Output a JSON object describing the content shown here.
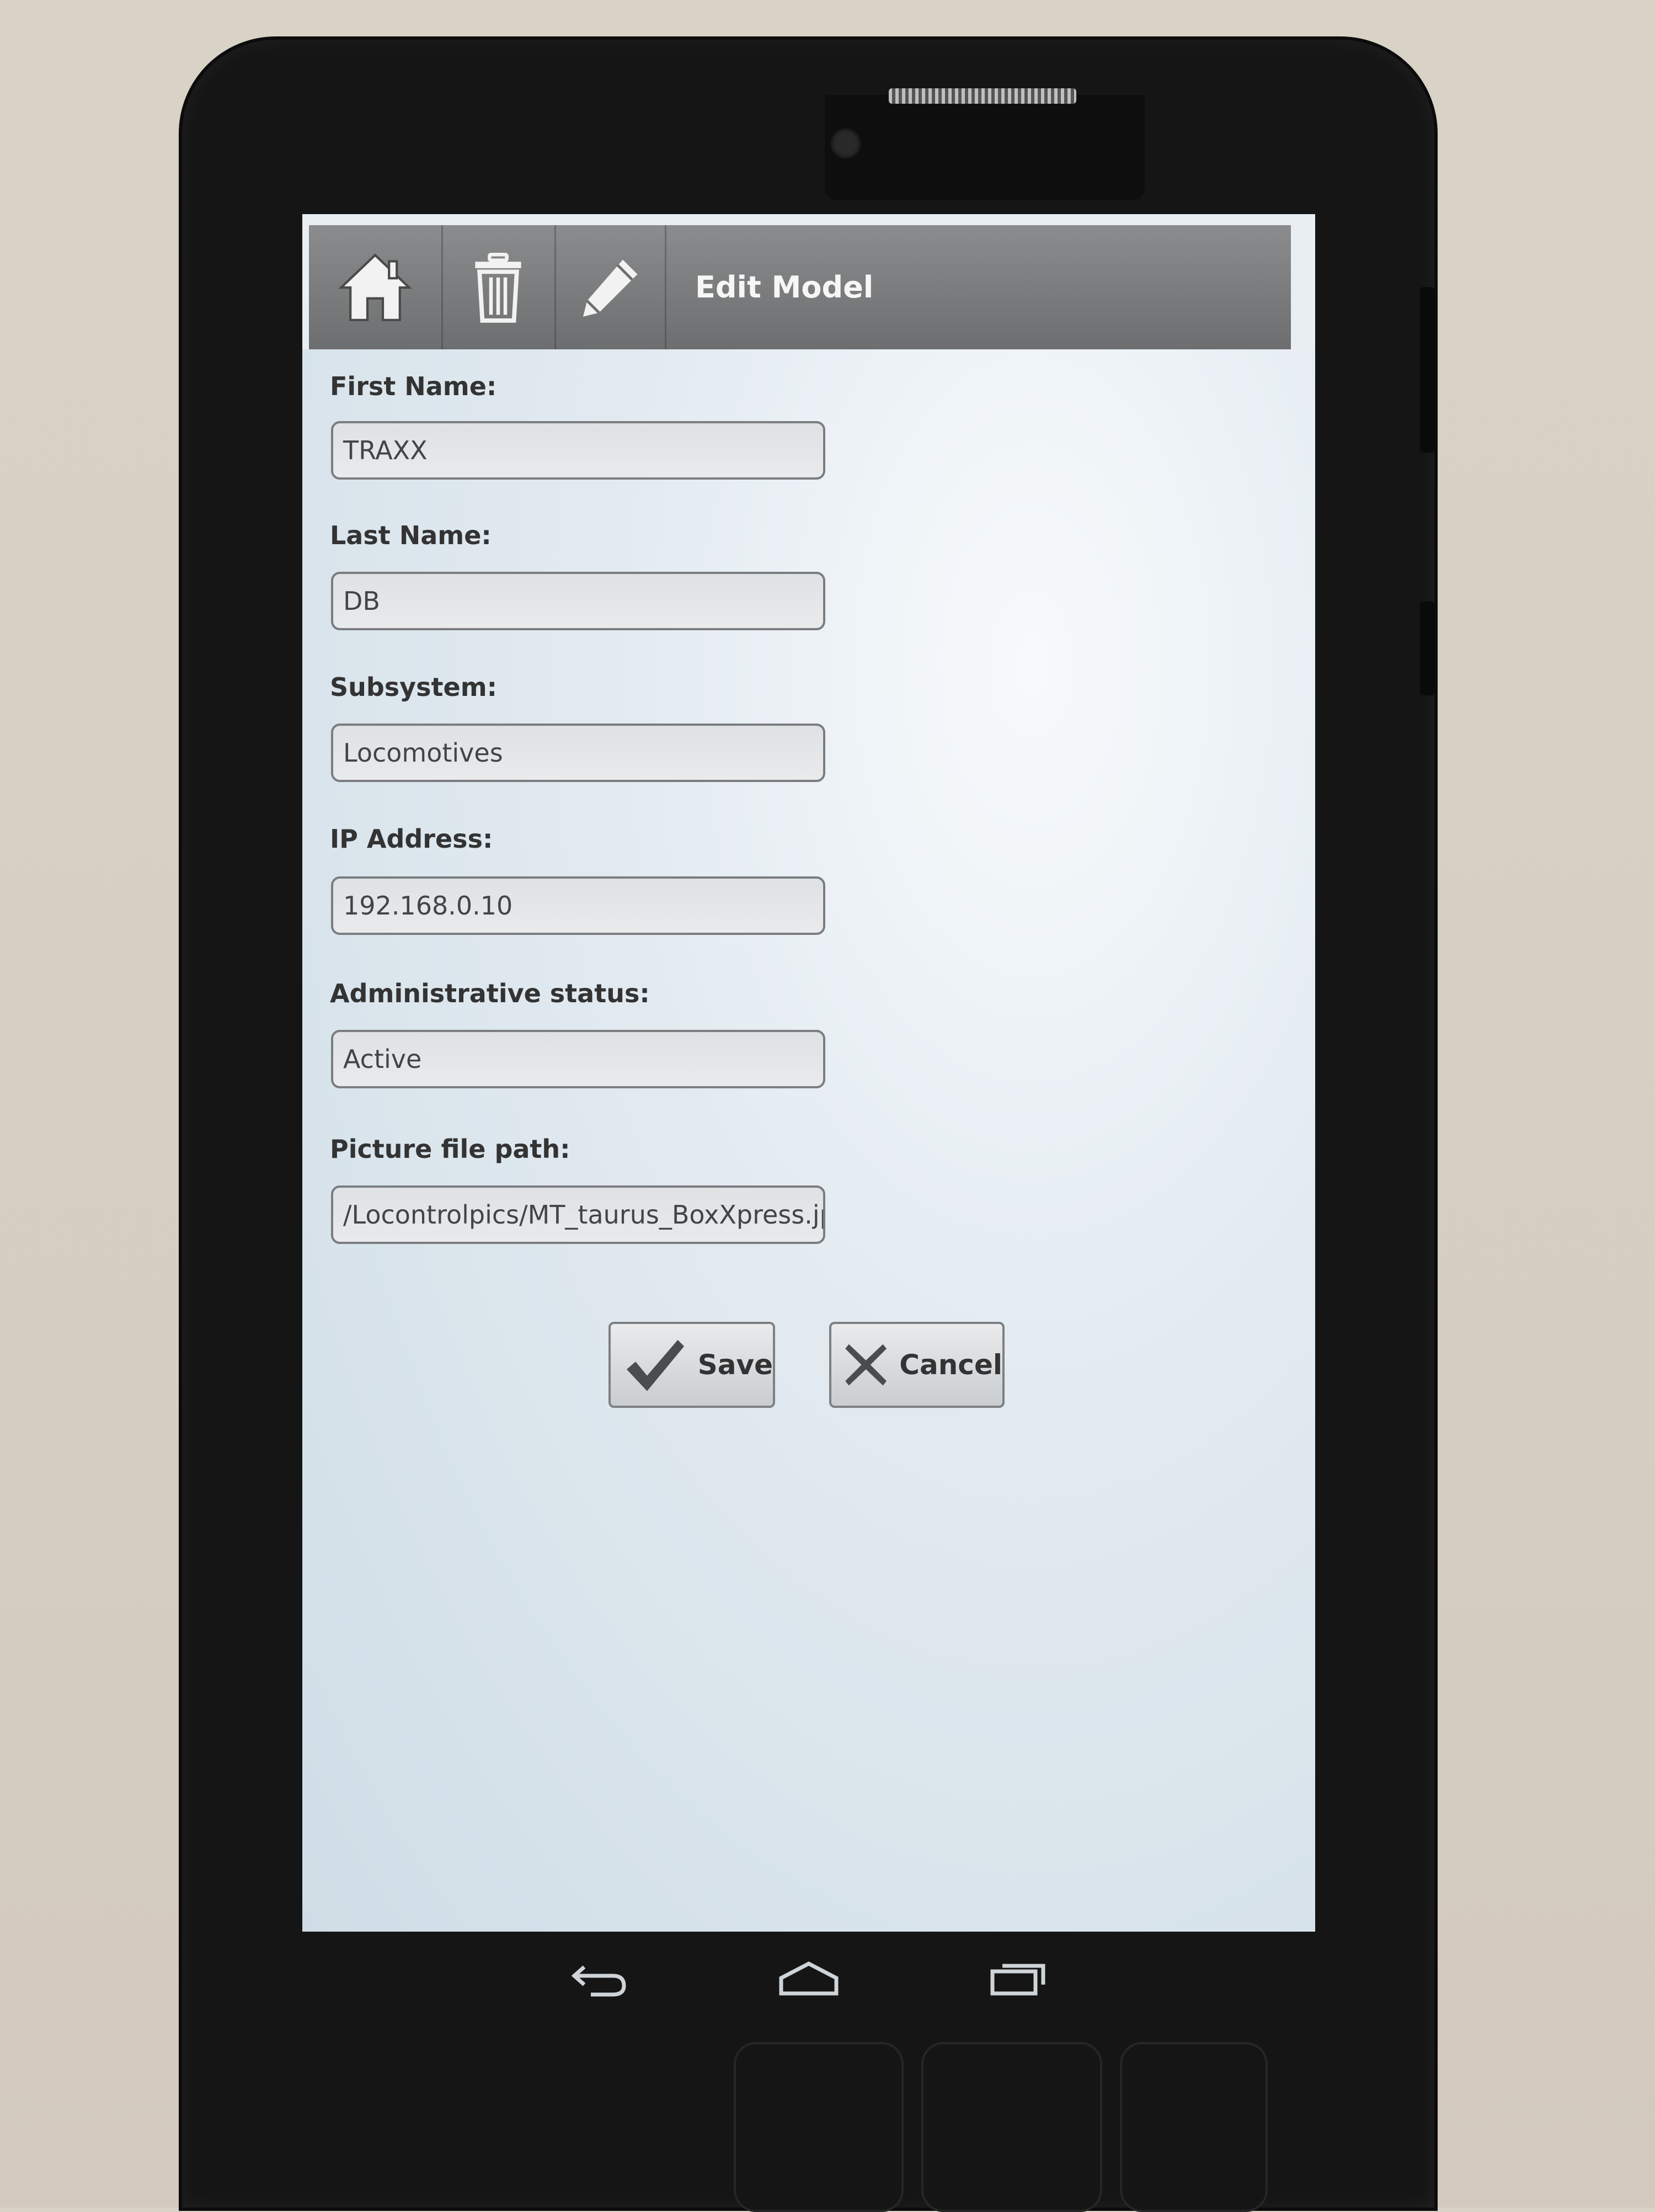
{
  "action_bar": {
    "title": "Edit Model",
    "icons": [
      "home-icon",
      "trash-icon",
      "pencil-icon"
    ]
  },
  "form": {
    "first_name": {
      "label": "First Name:",
      "value": "TRAXX"
    },
    "last_name": {
      "label": "Last Name:",
      "value": "DB"
    },
    "subsystem": {
      "label": "Subsystem:",
      "value": "Locomotives"
    },
    "ip_address": {
      "label": "IP Address:",
      "value": "192.168.0.10"
    },
    "admin_status": {
      "label": "Administrative status:",
      "value": "Active"
    },
    "picture_path": {
      "label": "Picture file path:",
      "value": "/Locontrolpics/MT_taurus_BoxXpress.jp"
    }
  },
  "buttons": {
    "save_label": "Save",
    "cancel_label": "Cancel"
  },
  "nav_bar": {
    "icons": [
      "back-icon",
      "home-nav-icon",
      "recent-apps-icon"
    ]
  }
}
